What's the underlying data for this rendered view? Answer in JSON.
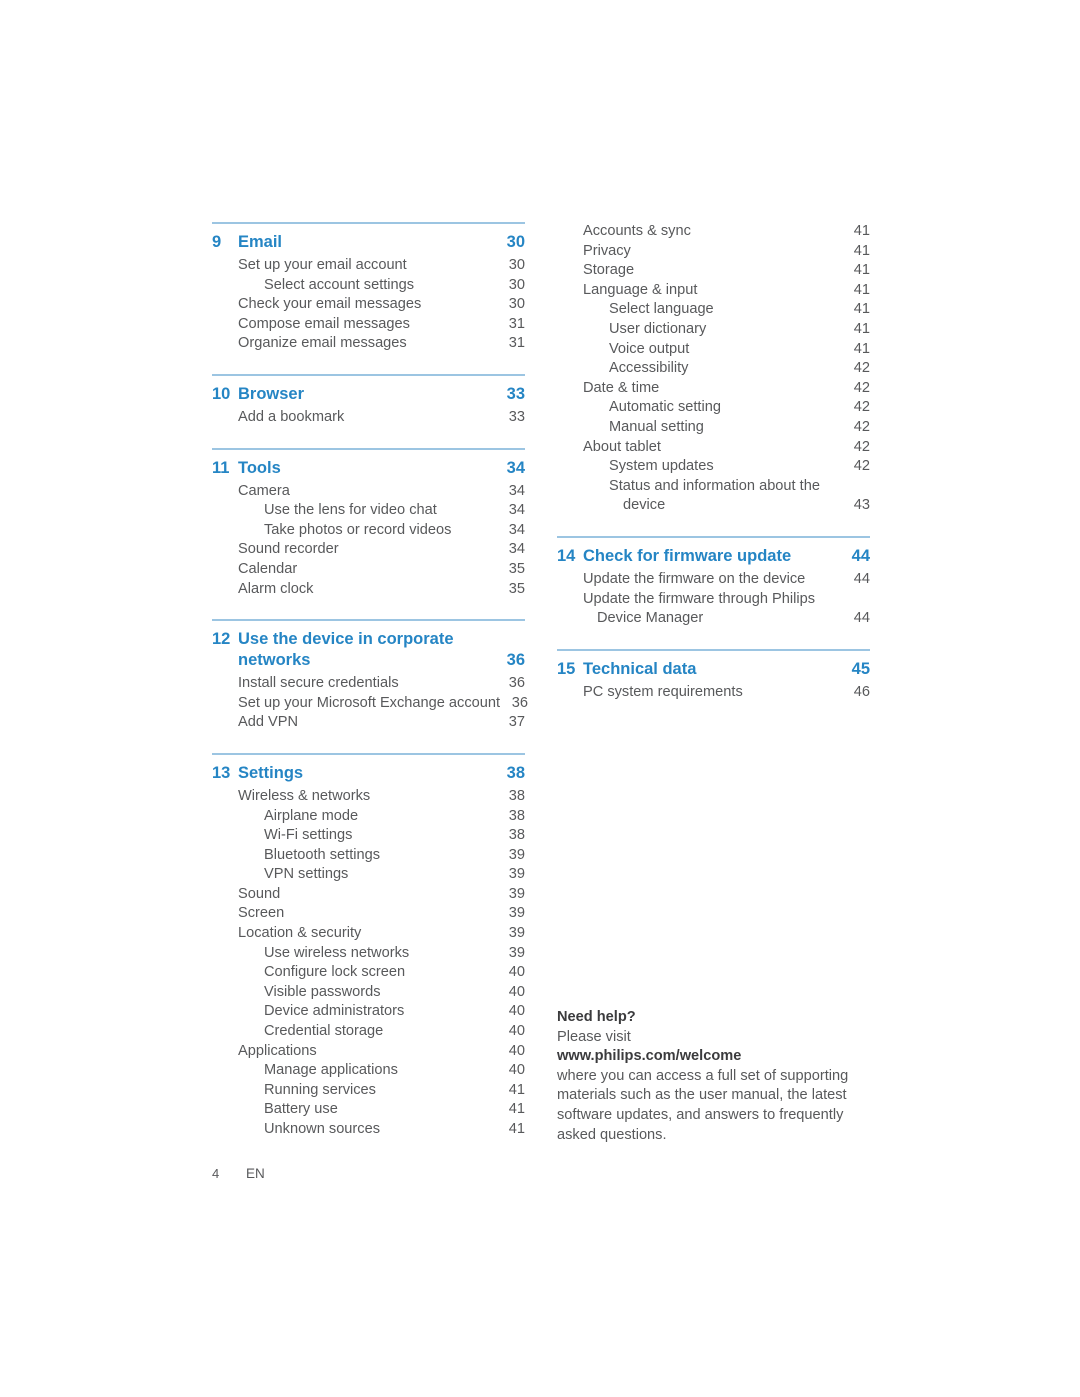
{
  "colors": {
    "heading_blue": "#2585c4",
    "rule_blue": "#9cc5e2",
    "body_gray": "#58595b"
  },
  "footer": {
    "page_number": "4",
    "language": "EN"
  },
  "left_column": {
    "groups": [
      {
        "number": "9",
        "title": "Email",
        "page": "30",
        "entries": [
          {
            "level": 1,
            "text": "Set up your email account",
            "page": "30"
          },
          {
            "level": 2,
            "text": "Select account settings",
            "page": "30"
          },
          {
            "level": 1,
            "text": "Check your email messages",
            "page": "30"
          },
          {
            "level": 1,
            "text": "Compose email messages",
            "page": "31"
          },
          {
            "level": 1,
            "text": "Organize email messages",
            "page": "31"
          }
        ]
      },
      {
        "number": "10",
        "title": "Browser",
        "page": "33",
        "entries": [
          {
            "level": 1,
            "text": "Add a bookmark",
            "page": "33"
          }
        ]
      },
      {
        "number": "11",
        "title": "Tools",
        "page": "34",
        "entries": [
          {
            "level": 1,
            "text": "Camera",
            "page": "34"
          },
          {
            "level": 2,
            "text": "Use the lens for video chat",
            "page": "34"
          },
          {
            "level": 2,
            "text": "Take photos or record videos",
            "page": "34"
          },
          {
            "level": 1,
            "text": "Sound recorder",
            "page": "34"
          },
          {
            "level": 1,
            "text": "Calendar",
            "page": "35"
          },
          {
            "level": 1,
            "text": "Alarm clock",
            "page": "35"
          }
        ]
      },
      {
        "number": "12",
        "title_line1": "Use the device in corporate",
        "title_line2": "networks",
        "page": "36",
        "entries": [
          {
            "level": 1,
            "text": "Install secure credentials",
            "page": "36"
          },
          {
            "level": 1,
            "text": "Set up your Microsoft Exchange account",
            "page": "36"
          },
          {
            "level": 1,
            "text": "Add VPN",
            "page": "37"
          }
        ]
      },
      {
        "number": "13",
        "title": "Settings",
        "page": "38",
        "entries": [
          {
            "level": 1,
            "text": "Wireless & networks",
            "page": "38"
          },
          {
            "level": 2,
            "text": "Airplane mode",
            "page": "38"
          },
          {
            "level": 2,
            "text": "Wi-Fi settings",
            "page": "38"
          },
          {
            "level": 2,
            "text": "Bluetooth settings",
            "page": "39"
          },
          {
            "level": 2,
            "text": "VPN settings",
            "page": "39"
          },
          {
            "level": 1,
            "text": "Sound",
            "page": "39"
          },
          {
            "level": 1,
            "text": "Screen",
            "page": "39"
          },
          {
            "level": 1,
            "text": "Location & security",
            "page": "39"
          },
          {
            "level": 2,
            "text": "Use wireless networks",
            "page": "39"
          },
          {
            "level": 2,
            "text": "Configure lock screen",
            "page": "40"
          },
          {
            "level": 2,
            "text": "Visible passwords",
            "page": "40"
          },
          {
            "level": 2,
            "text": "Device administrators",
            "page": "40"
          },
          {
            "level": 2,
            "text": "Credential storage",
            "page": "40"
          },
          {
            "level": 1,
            "text": "Applications",
            "page": "40"
          },
          {
            "level": 2,
            "text": "Manage applications",
            "page": "40"
          },
          {
            "level": 2,
            "text": "Running services",
            "page": "41"
          },
          {
            "level": 2,
            "text": "Battery use",
            "page": "41"
          },
          {
            "level": 2,
            "text": "Unknown sources",
            "page": "41"
          }
        ]
      }
    ]
  },
  "right_column": {
    "continued_entries": [
      {
        "level": 1,
        "text": "Accounts & sync",
        "page": "41"
      },
      {
        "level": 1,
        "text": "Privacy",
        "page": "41"
      },
      {
        "level": 1,
        "text": "Storage",
        "page": "41"
      },
      {
        "level": 1,
        "text": "Language & input",
        "page": "41"
      },
      {
        "level": 2,
        "text": "Select language",
        "page": "41"
      },
      {
        "level": 2,
        "text": "User dictionary",
        "page": "41"
      },
      {
        "level": 2,
        "text": "Voice output",
        "page": "41"
      },
      {
        "level": 2,
        "text": "Accessibility",
        "page": "42"
      },
      {
        "level": 1,
        "text": "Date & time",
        "page": "42"
      },
      {
        "level": 2,
        "text": "Automatic setting",
        "page": "42"
      },
      {
        "level": 2,
        "text": "Manual setting",
        "page": "42"
      },
      {
        "level": 1,
        "text": "About tablet",
        "page": "42"
      },
      {
        "level": 2,
        "text": "System updates",
        "page": "42"
      }
    ],
    "wrapped_entry": {
      "level": 2,
      "line1": "Status and information about the",
      "line2": "device",
      "page": "43"
    },
    "groups": [
      {
        "number": "14",
        "title": "Check for firmware update",
        "page": "44",
        "entries": [
          {
            "level": 1,
            "text": "Update the firmware on the device",
            "page": "44"
          }
        ],
        "wrapped_entry": {
          "level": 1,
          "line1": "Update the firmware through Philips",
          "line2": "Device Manager",
          "page": "44"
        }
      },
      {
        "number": "15",
        "title": "Technical data",
        "page": "45",
        "entries": [
          {
            "level": 1,
            "text": "PC system requirements",
            "page": "46"
          }
        ]
      }
    ]
  },
  "need_help": {
    "heading": "Need help?",
    "please_visit": "Please visit",
    "url": "www.philips.com/welcome",
    "body": "where you can access a full set of supporting materials such as the user manual, the latest software updates, and answers to frequently asked questions."
  }
}
